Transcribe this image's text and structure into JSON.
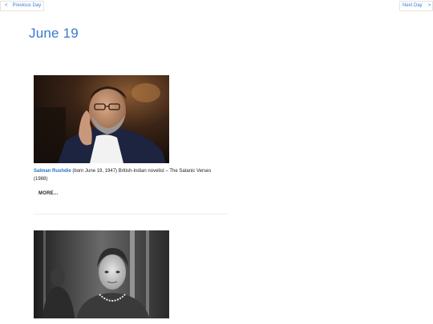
{
  "nav": {
    "prev_chevron": "<",
    "prev_label": "Previous Day",
    "next_label": "Next Day",
    "next_chevron": ">"
  },
  "page": {
    "title": "June 19"
  },
  "entries": [
    {
      "name": "Salman Rushdie",
      "description": " (born June 19, 1947) British-Indian novelist – The Satanic Verses (1988)",
      "more_label": "MORE..."
    },
    {
      "name": "",
      "description": "",
      "more_label": ""
    }
  ],
  "colors": {
    "accent": "#3a77cf",
    "link": "#1f73c9"
  }
}
